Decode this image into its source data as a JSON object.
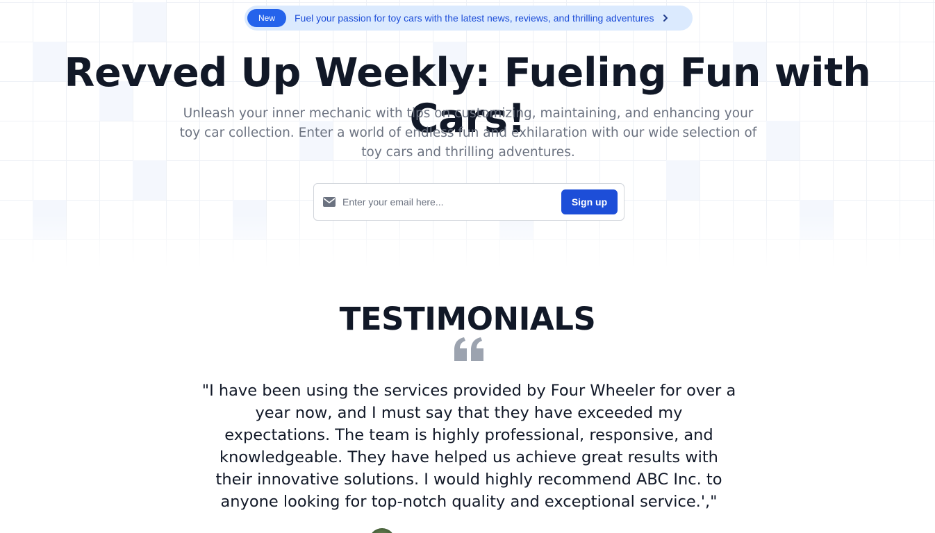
{
  "announcement": {
    "badge": "New",
    "text": "Fuel your passion for toy cars with the latest news, reviews, and thrilling adventures",
    "arrow_icon": "chevron-right-icon"
  },
  "hero": {
    "title": "Revved Up Weekly: Fueling Fun with Cars!",
    "subtitle": "Unleash your inner mechanic with tips on customizing, maintaining, and enhancing your toy car collection. Enter a world of endless fun and exhilaration with our wide selection of toy cars and thrilling adventures."
  },
  "signup_form": {
    "mail_icon": "envelope-icon",
    "email_placeholder": "Enter your email here...",
    "email_value": "",
    "button_label": "Sign up"
  },
  "testimonials": {
    "heading": "TESTIMONIALS",
    "quote_icon": "quote-icon",
    "quote": "\"I have been using the services provided by Four Wheeler for over a year now, and I must say that they have exceeded my expectations. The team is highly professional, responsive, and knowledgeable. They have helped us achieve great results with their innovative solutions. I would highly recommend ABC Inc. to anyone looking for top-notch quality and exceptional service.',\""
  },
  "colors": {
    "accent": "#2563eb",
    "accent_light": "#dbeafe",
    "heading": "#111827",
    "muted": "#6b7280"
  }
}
